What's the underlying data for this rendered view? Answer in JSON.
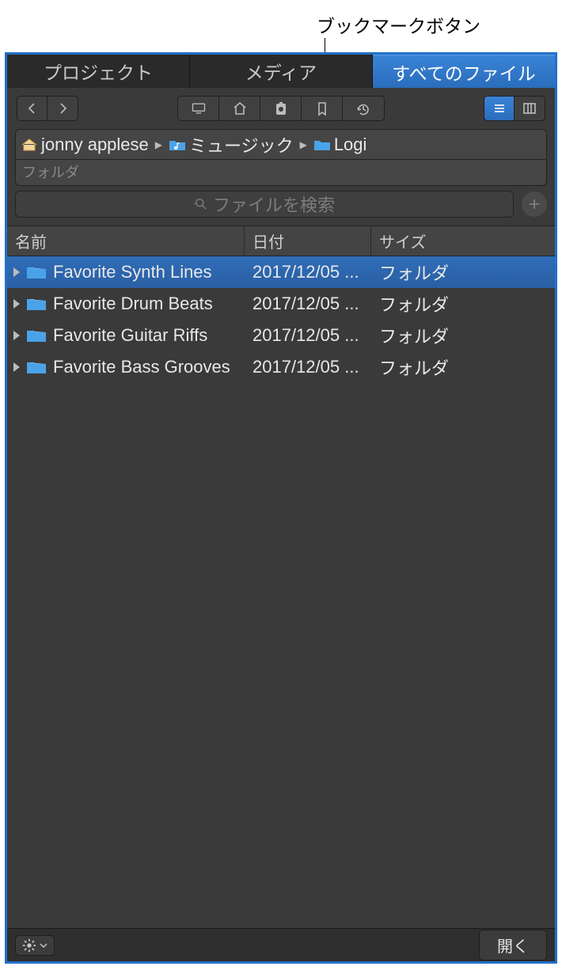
{
  "callout": {
    "label": "ブックマークボタン"
  },
  "tabs": [
    {
      "label": "プロジェクト",
      "active": false
    },
    {
      "label": "メディア",
      "active": false
    },
    {
      "label": "すべてのファイル",
      "active": true
    }
  ],
  "breadcrumb": {
    "items": [
      {
        "label": "jonny applese",
        "icon": "home"
      },
      {
        "label": "ミュージック",
        "icon": "music-folder"
      },
      {
        "label": "Logi",
        "icon": "folder"
      }
    ],
    "type_label": "フォルダ"
  },
  "search": {
    "placeholder": "ファイルを検索"
  },
  "columns": {
    "name": "名前",
    "date": "日付",
    "size": "サイズ"
  },
  "rows": [
    {
      "name": "Favorite Synth Lines",
      "date": "2017/12/05 ...",
      "size": "フォルダ",
      "selected": true
    },
    {
      "name": "Favorite Drum Beats",
      "date": "2017/12/05 ...",
      "size": "フォルダ",
      "selected": false
    },
    {
      "name": "Favorite Guitar Riffs",
      "date": "2017/12/05 ...",
      "size": "フォルダ",
      "selected": false
    },
    {
      "name": "Favorite Bass Grooves",
      "date": "2017/12/05 ...",
      "size": "フォルダ",
      "selected": false
    }
  ],
  "footer": {
    "open": "開く"
  }
}
